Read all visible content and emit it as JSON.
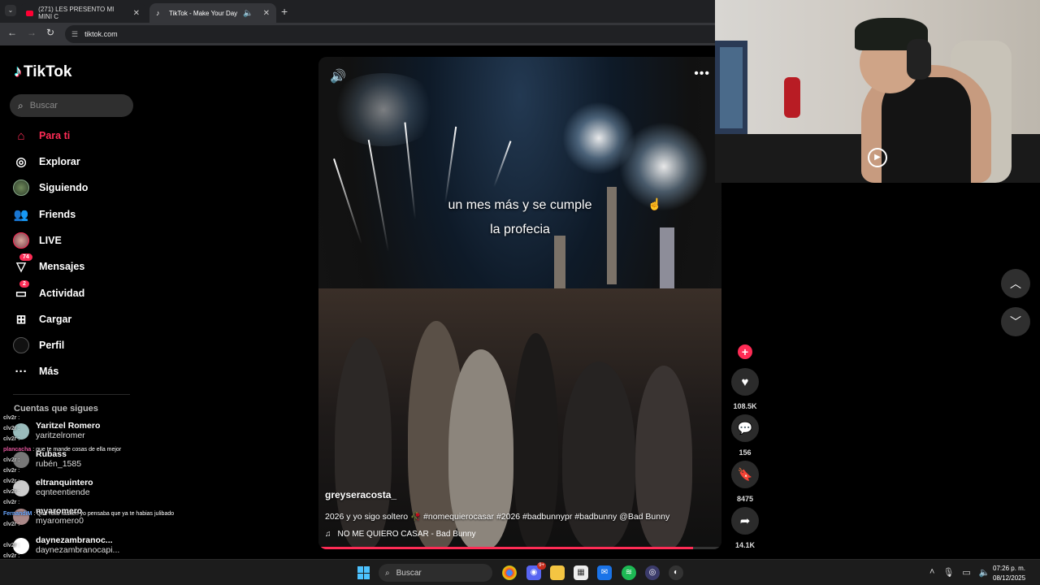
{
  "browser": {
    "tabs": [
      {
        "title": "(271) LES PRESENTO MI MINI C",
        "icon": "youtube-icon"
      },
      {
        "title": "TikTok - Make Your Day",
        "icon": "tiktok-icon",
        "active": true
      }
    ],
    "url": "tiktok.com"
  },
  "sidebar": {
    "logo": "TikTok",
    "search_placeholder": "Buscar",
    "items": [
      {
        "label": "Para ti",
        "icon": "home-icon",
        "active": true
      },
      {
        "label": "Explorar",
        "icon": "compass-icon"
      },
      {
        "label": "Siguiendo",
        "icon": "following-avatar-icon"
      },
      {
        "label": "Friends",
        "icon": "friends-icon"
      },
      {
        "label": "LIVE",
        "icon": "live-avatar-icon"
      },
      {
        "label": "Mensajes",
        "icon": "messages-icon",
        "badge": "74"
      },
      {
        "label": "Actividad",
        "icon": "activity-icon",
        "badge": "2"
      },
      {
        "label": "Cargar",
        "icon": "upload-icon"
      },
      {
        "label": "Perfil",
        "icon": "profile-icon"
      },
      {
        "label": "Más",
        "icon": "more-icon"
      }
    ],
    "following_title": "Cuentas que sigues",
    "following": [
      {
        "name": "Yaritzel Romero",
        "user": "yaritzelromer"
      },
      {
        "name": "Rubass",
        "user": "rubén_1585"
      },
      {
        "name": "eltranquintero",
        "user": "eqnteentiende"
      },
      {
        "name": "myaromero",
        "user": "myaromero0"
      },
      {
        "name": "daynezambranoc...",
        "user": "daynezambranocapi..."
      }
    ]
  },
  "chat": [
    {
      "user": "clv2r",
      "msg": ""
    },
    {
      "user": "clv2r",
      "msg": ""
    },
    {
      "user": "clv2r",
      "msg": ""
    },
    {
      "user": "plancacha",
      "msg": "que te mande cosas de ella mejor"
    },
    {
      "user": "clv2r",
      "msg": ""
    },
    {
      "user": "clv2r",
      "msg": ""
    },
    {
      "user": "clv2r",
      "msg": ""
    },
    {
      "user": "clv2r",
      "msg": ""
    },
    {
      "user": "clv2r",
      "msg": ""
    },
    {
      "user": "FernandiM",
      "msg": "Que rollo rasken yo pensaba que ya te habias julibado"
    },
    {
      "user": "clv2r",
      "msg": ""
    },
    {
      "user": "clv2r",
      "msg": ""
    },
    {
      "user": "clv2r",
      "msg": ""
    },
    {
      "user": "clv2r",
      "msg": ""
    }
  ],
  "video": {
    "caption_line1": "un mes más y se cumple",
    "caption_line2": "la profecia",
    "author": "greyseracosta_",
    "description": "2026 y yo sigo soltero 🥀 #nomequierocasar #2026 #badbunnypr #badbunny @Bad Bunny",
    "music": "NO ME QUIERO CASAR - Bad Bunny",
    "progress": 0.93
  },
  "actions": {
    "likes": "108.5K",
    "comments": "156",
    "saves": "8475",
    "shares": "14.1K"
  },
  "taskbar": {
    "search": "Buscar",
    "time": "07:26 p. m.",
    "date": "08/12/2025",
    "discord_badge": "9+"
  }
}
